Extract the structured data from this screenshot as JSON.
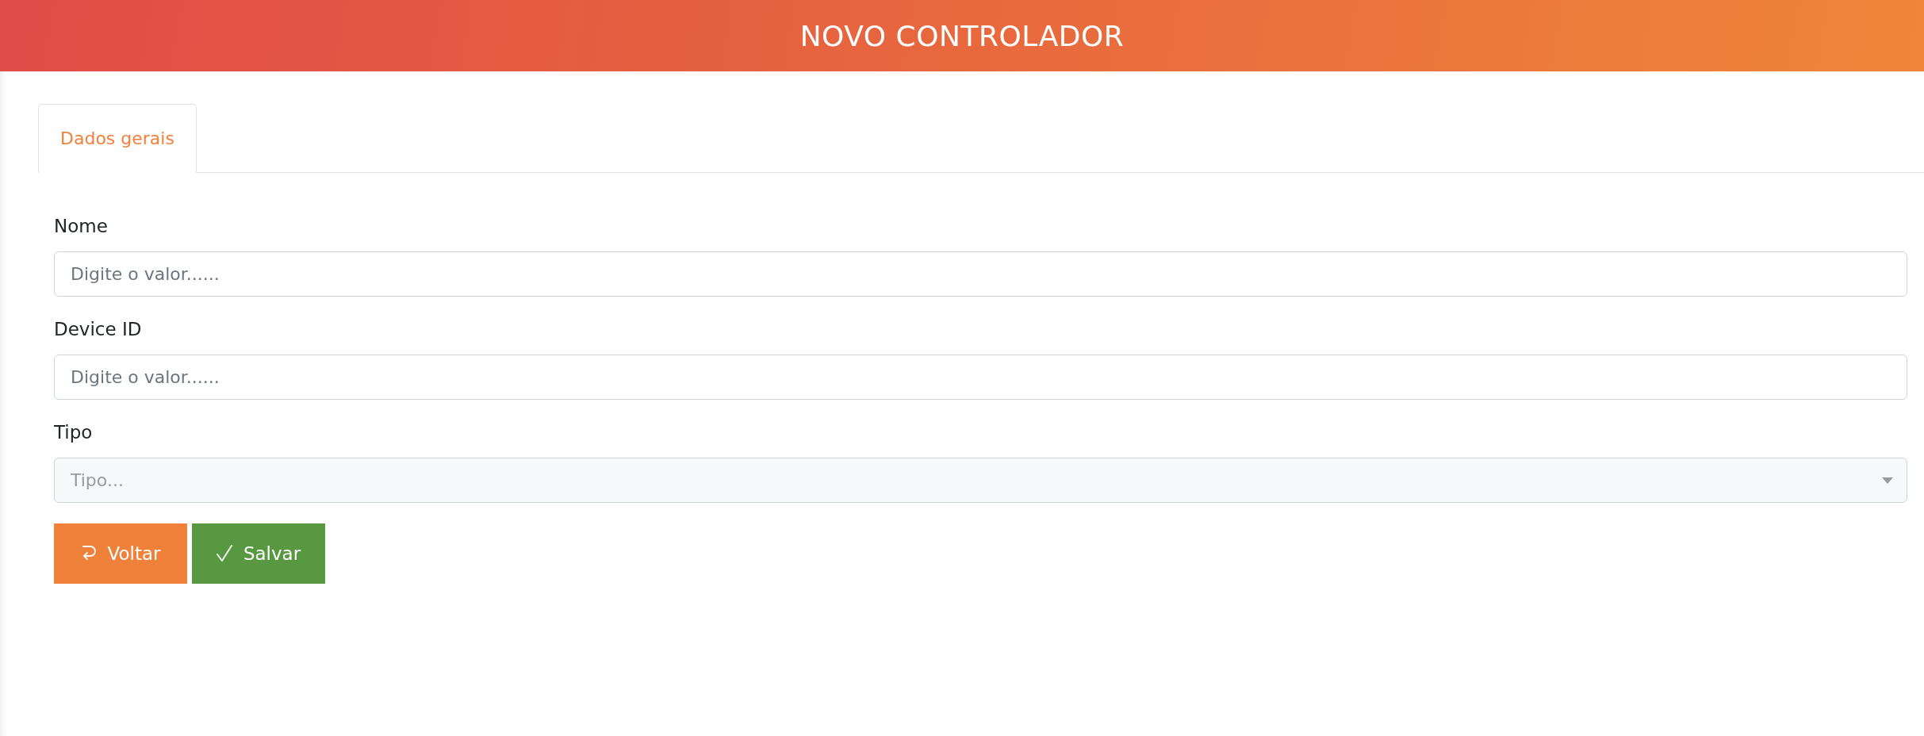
{
  "header": {
    "title": "NOVO CONTROLADOR"
  },
  "tabs": [
    {
      "label": "Dados gerais",
      "selected": true
    }
  ],
  "form": {
    "fields": [
      {
        "kind": "text",
        "label": "Nome",
        "placeholder": "Digite o valor......"
      },
      {
        "kind": "text",
        "label": "Device ID",
        "placeholder": "Digite o valor......"
      },
      {
        "kind": "select",
        "label": "Tipo",
        "placeholder": "Tipo..."
      }
    ]
  },
  "buttons": [
    {
      "kind": "back",
      "label": "Voltar"
    },
    {
      "kind": "save",
      "label": "Salvar"
    }
  ]
}
